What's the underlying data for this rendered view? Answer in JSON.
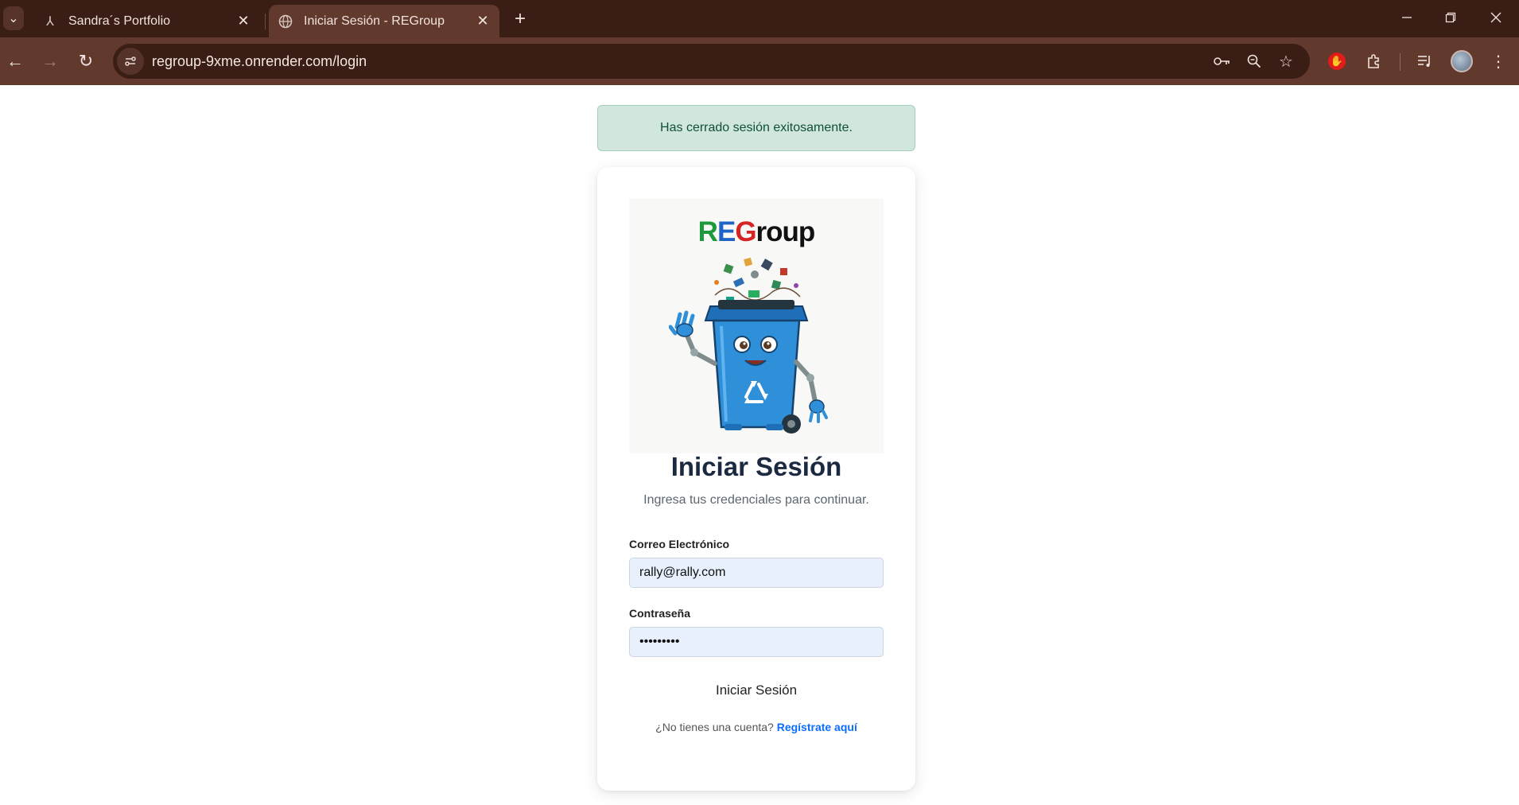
{
  "browser": {
    "tabs": [
      {
        "title": "Sandra´s Portfolio",
        "favicon": "portfolio-icon",
        "active": false
      },
      {
        "title": "Iniciar Sesión - REGroup",
        "favicon": "globe-icon",
        "active": true
      }
    ],
    "url": "regroup-9xme.onrender.com/login",
    "new_tab": "+",
    "window_controls": [
      "minimize",
      "restore",
      "close"
    ]
  },
  "page": {
    "alert": "Has cerrado sesión exitosamente.",
    "logo": {
      "r": "R",
      "e": "E",
      "g": "G",
      "rest": "roup"
    },
    "heading": "Iniciar Sesión",
    "subtitle": "Ingresa tus credenciales para continuar.",
    "email": {
      "label": "Correo Electrónico",
      "value": "rally@rally.com"
    },
    "password": {
      "label": "Contraseña",
      "value": "•••••••••"
    },
    "submit_label": "Iniciar Sesión",
    "register": {
      "prompt": "¿No tienes una cuenta?",
      "link": "Regístrate aquí"
    }
  }
}
